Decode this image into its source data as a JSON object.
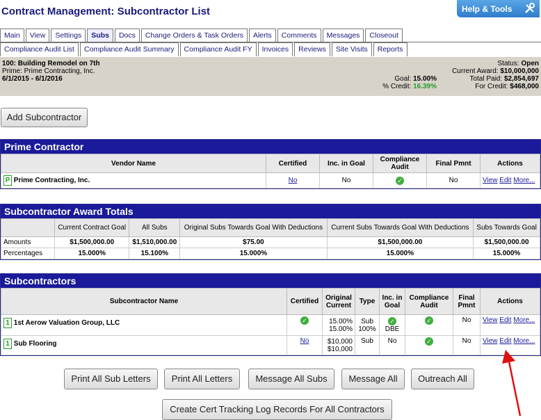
{
  "page_title": "Contract Management: Subcontractor List",
  "help_label": "Help & Tools",
  "tabs_row1": [
    "Main",
    "View",
    "Settings",
    "Subs",
    "Docs",
    "Change Orders & Task Orders",
    "Alerts",
    "Comments",
    "Messages",
    "Closeout"
  ],
  "tabs_row2": [
    "Compliance Audit List",
    "Compliance Audit Summary",
    "Compliance Audit FY",
    "Invoices",
    "Reviews",
    "Site Visits",
    "Reports"
  ],
  "active_tab": "Subs",
  "contract": {
    "name": "100: Building Remodel on 7th",
    "prime": "Prime: Prime Contracting, Inc.",
    "dates": "6/1/2015 - 6/1/2016",
    "goal_label": "Goal:",
    "goal": "15.00%",
    "credit_label": "% Credit:",
    "credit": "16.39%",
    "status_label": "Status:",
    "status": "Open",
    "award_label": "Current Award:",
    "award": "$10,000,000",
    "paid_label": "Total Paid:",
    "paid": "$2,854,697",
    "forcredit_label": "For Credit:",
    "forcredit": "$468,000"
  },
  "add_sub_button": "Add Subcontractor",
  "prime_panel": {
    "title": "Prime Contractor",
    "headers": [
      "Vendor Name",
      "Certified",
      "Inc. in Goal",
      "Compliance Audit",
      "Final Pmnt",
      "Actions"
    ],
    "row": {
      "badge": "P",
      "name": "Prime Contracting, Inc.",
      "certified": "No",
      "inc_goal": "No",
      "final_pmnt": "No"
    }
  },
  "award_panel": {
    "title": "Subcontractor Award Totals",
    "headers": [
      "Current Contract Goal",
      "All Subs",
      "Original Subs Towards Goal With Deductions",
      "Current Subs Towards Goal With Deductions",
      "Subs Towards Goal"
    ],
    "amounts_label": "Amounts",
    "amounts": [
      "$1,500,000.00",
      "$1,510,000.00",
      "$75.00",
      "$1,500,000.00",
      "$1,500,000.00"
    ],
    "percent_label": "Percentages",
    "percentages": [
      "15.000%",
      "15.100%",
      "15.000%",
      "15.000%",
      "15.000%"
    ]
  },
  "subs_panel": {
    "title": "Subcontractors",
    "headers": [
      "Subcontractor Name",
      "Certified",
      "Original Current",
      "Type",
      "Inc. in Goal",
      "Compliance Audit",
      "Final Pmnt",
      "Actions"
    ],
    "rows": [
      {
        "badge": "1",
        "name": "1st Aerow Valuation Group, LLC",
        "amount1": "15.00%",
        "amount2": "15.00%",
        "type1": "Sub",
        "type2": "100%",
        "inc_sub": "DBE",
        "final_pmnt": "No"
      },
      {
        "badge": "1",
        "name": "Sub Flooring",
        "certified": "No",
        "amount1": "$10,000",
        "amount2": "$10,000",
        "type1": "Sub",
        "inc": "No",
        "final_pmnt": "No"
      }
    ]
  },
  "actions": {
    "view": "View",
    "edit": "Edit",
    "more": "More..."
  },
  "bottom_buttons": [
    "Print All Sub Letters",
    "Print All Letters",
    "Message All Subs",
    "Message All",
    "Outreach All"
  ],
  "cert_button": "Create Cert Tracking Log Records For All Contractors",
  "colors": {
    "header_blue": "#1a1a9a",
    "check_green": "#3fae3f",
    "info_bg": "#d7d3c9",
    "arrow_red": "#e01010"
  }
}
